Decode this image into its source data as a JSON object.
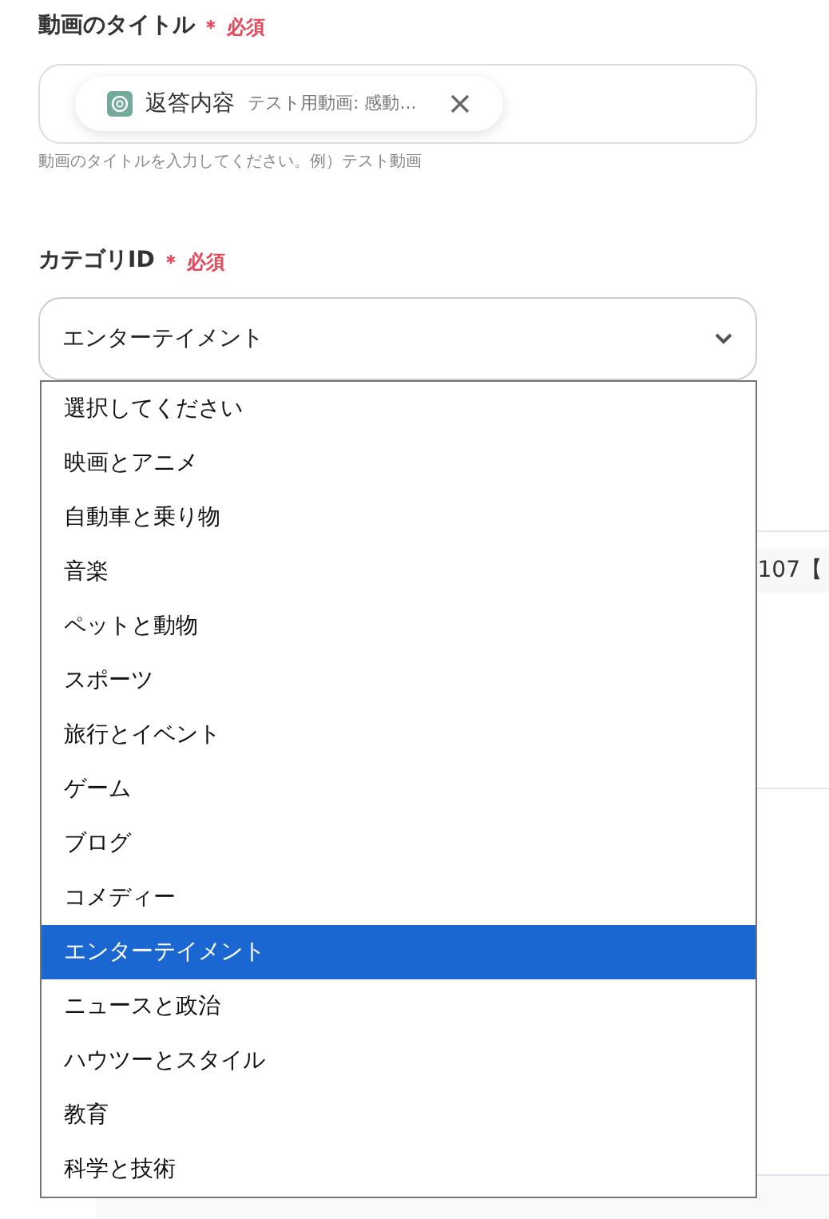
{
  "title_field": {
    "label": "動画のタイトル",
    "required_mark": "＊",
    "required": "必須",
    "chip": {
      "label": "返答内容",
      "value": "テスト用動画: 感動..."
    },
    "help": "動画のタイトルを入力してください。例）テスト動画"
  },
  "category_field": {
    "label": "カテゴリID",
    "required_mark": "＊",
    "required": "必須",
    "value": "エンターテイメント",
    "expanded": true
  },
  "options": [
    {
      "label": "選択してください",
      "selected": false
    },
    {
      "label": "映画とアニメ",
      "selected": false
    },
    {
      "label": "自動車と乗り物",
      "selected": false
    },
    {
      "label": "音楽",
      "selected": false
    },
    {
      "label": "ペットと動物",
      "selected": false
    },
    {
      "label": "スポーツ",
      "selected": false
    },
    {
      "label": "旅行とイベント",
      "selected": false
    },
    {
      "label": "ゲーム",
      "selected": false
    },
    {
      "label": "ブログ",
      "selected": false
    },
    {
      "label": "コメディー",
      "selected": false
    },
    {
      "label": "エンターテイメント",
      "selected": true
    },
    {
      "label": "ニュースと政治",
      "selected": false
    },
    {
      "label": "ハウツーとスタイル",
      "selected": false
    },
    {
      "label": "教育",
      "selected": false
    },
    {
      "label": "科学と技術",
      "selected": false
    }
  ],
  "background_text": "107【"
}
